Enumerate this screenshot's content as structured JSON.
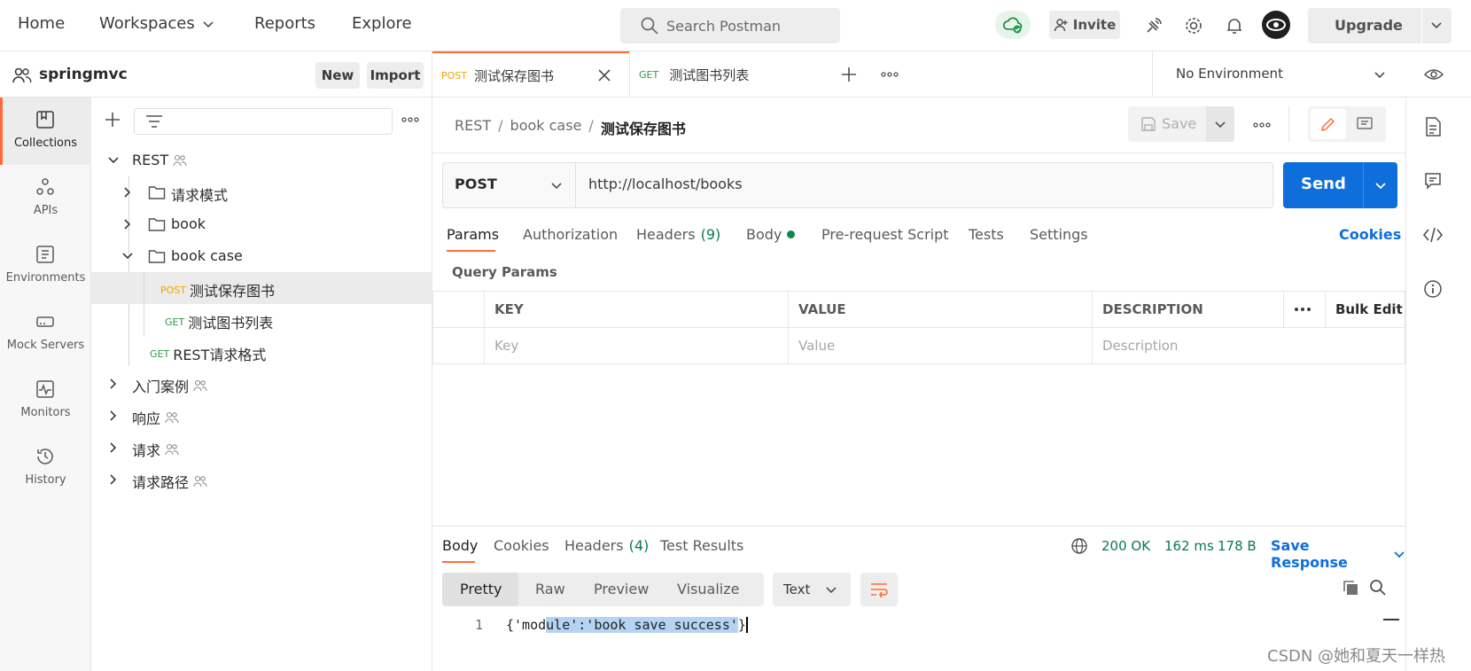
{
  "nav": {
    "home": "Home",
    "workspaces": "Workspaces",
    "reports": "Reports",
    "explore": "Explore",
    "search_placeholder": "Search Postman",
    "invite": "Invite",
    "upgrade": "Upgrade"
  },
  "workspace": {
    "name": "springmvc",
    "new_label": "New",
    "import_label": "Import"
  },
  "rail": [
    {
      "label": "Collections",
      "icon": "collections-icon",
      "active": true
    },
    {
      "label": "APIs",
      "icon": "apis-icon"
    },
    {
      "label": "Environments",
      "icon": "environments-icon"
    },
    {
      "label": "Mock Servers",
      "icon": "mock-servers-icon"
    },
    {
      "label": "Monitors",
      "icon": "monitors-icon"
    },
    {
      "label": "History",
      "icon": "history-icon"
    }
  ],
  "tree": {
    "root": "REST",
    "folders": [
      "请求模式",
      "book",
      "book case"
    ],
    "requests": [
      {
        "method": "POST",
        "name": "测试保存图书"
      },
      {
        "method": "GET",
        "name": "测试图书列表"
      },
      {
        "method": "GET",
        "name": "REST请求格式"
      }
    ],
    "collections": [
      "入门案例",
      "响应",
      "请求",
      "请求路径"
    ]
  },
  "tabs": [
    {
      "method": "POST",
      "name": "测试保存图书",
      "active": true
    },
    {
      "method": "GET",
      "name": "测试图书列表"
    }
  ],
  "environment": "No Environment",
  "breadcrumb": {
    "part1": "REST",
    "part2": "book case",
    "current": "测试保存图书",
    "sep": "/"
  },
  "save_label": "Save",
  "request": {
    "method": "POST",
    "url": "http://localhost/books",
    "send": "Send"
  },
  "request_tabs": {
    "params": "Params",
    "authorization": "Authorization",
    "headers": "Headers",
    "headers_count": "(9)",
    "body": "Body",
    "prerequest": "Pre-request Script",
    "tests": "Tests",
    "settings": "Settings",
    "cookies": "Cookies"
  },
  "query": {
    "title": "Query Params",
    "col_key": "KEY",
    "col_value": "VALUE",
    "col_desc": "DESCRIPTION",
    "bulk_edit": "Bulk Edit",
    "ph_key": "Key",
    "ph_value": "Value",
    "ph_desc": "Description"
  },
  "response": {
    "tab_body": "Body",
    "tab_cookies": "Cookies",
    "tab_headers": "Headers",
    "headers_count": "(4)",
    "tab_tests": "Test Results",
    "status": "200 OK",
    "time": "162 ms",
    "size": "178 B",
    "save_response": "Save Response",
    "formats": [
      "Pretty",
      "Raw",
      "Preview",
      "Visualize"
    ],
    "lang": "Text",
    "line_no": "1",
    "code_pre": "{'mod",
    "code_sel": "ule':'book save success'",
    "code_post": "}"
  },
  "watermark": "CSDN @她和夏天一样热",
  "colors": {
    "accent": "#ff6c37",
    "send": "#0d6edc",
    "post": "#f0a500",
    "get": "#2e9a46",
    "status_ok": "#0b7a4b",
    "link": "#0d6edc",
    "selection": "#b5d4f4"
  }
}
